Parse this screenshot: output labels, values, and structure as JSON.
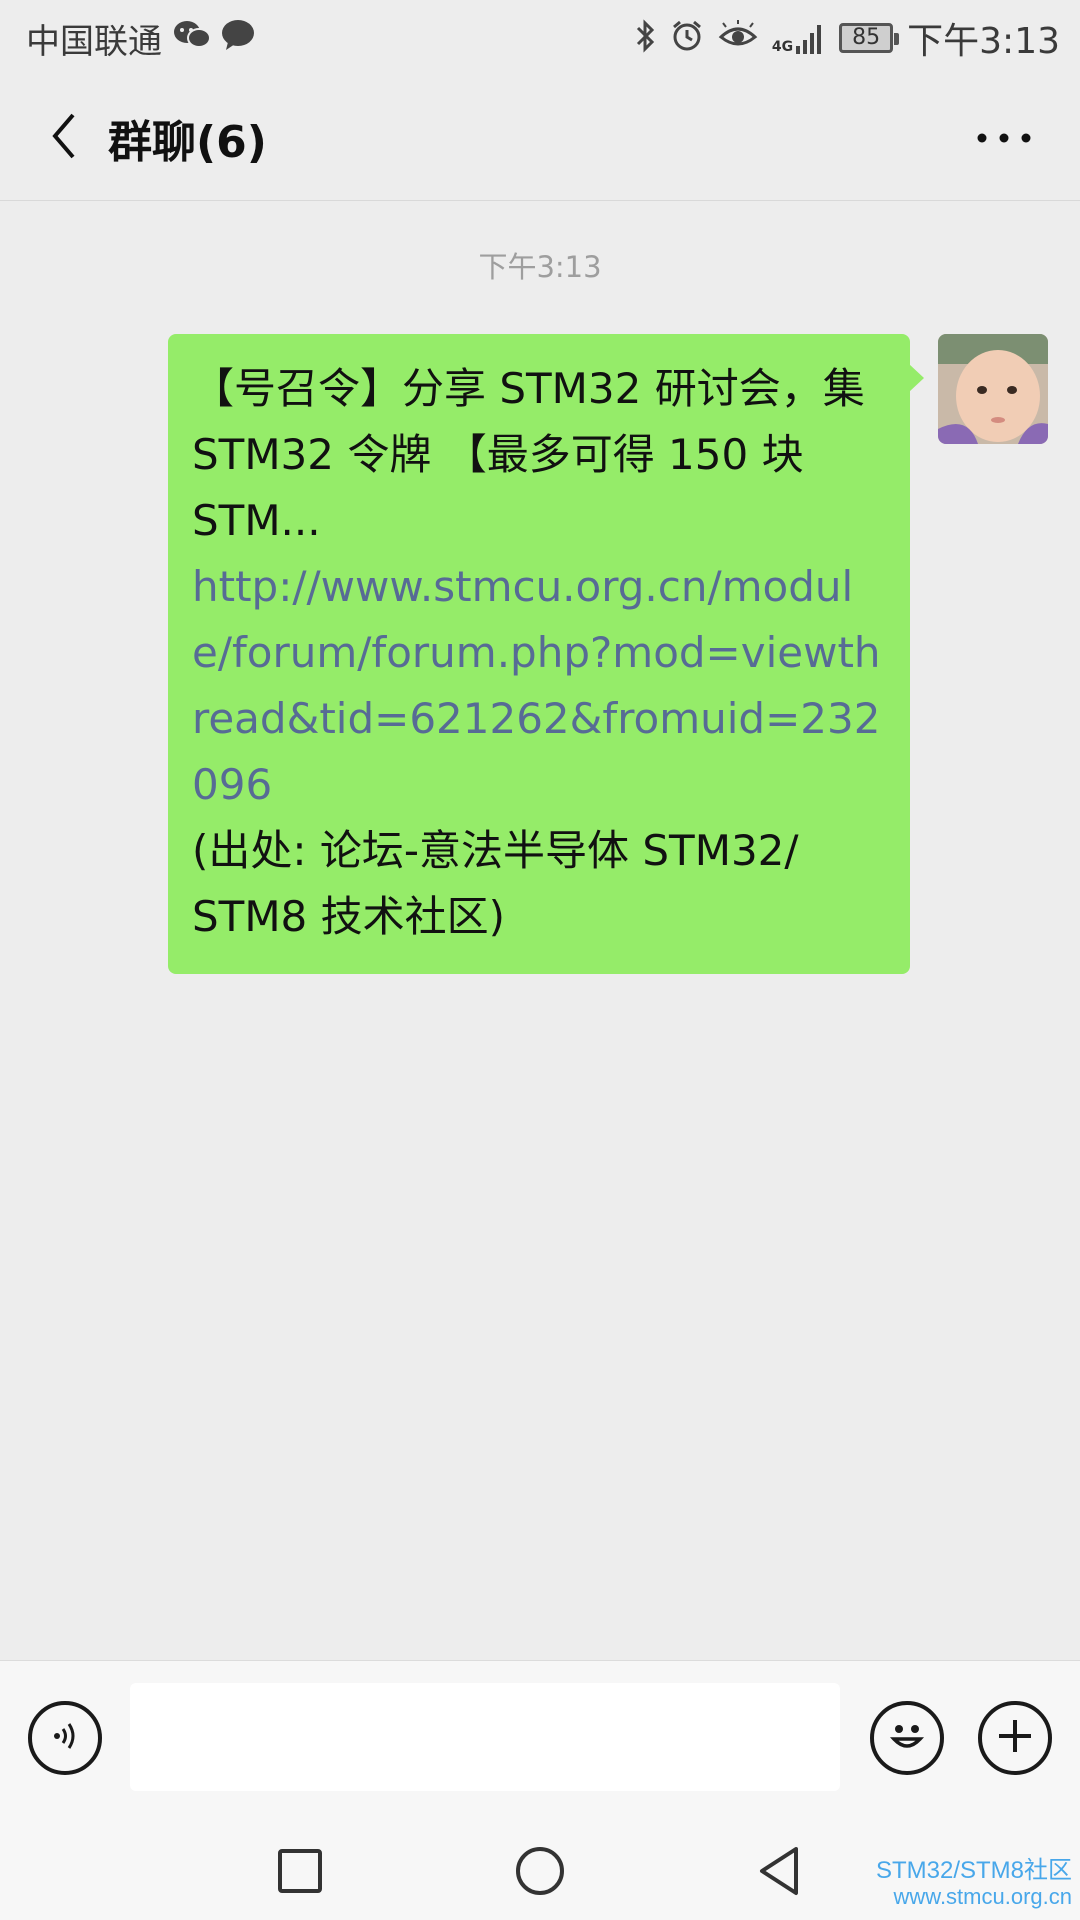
{
  "status_bar": {
    "carrier": "中国联通",
    "network_type": "4G",
    "battery": "85",
    "time": "下午3:13",
    "left_icons": [
      "wechat-icon",
      "message-icon"
    ],
    "right_icons": [
      "bluetooth-icon",
      "alarm-icon",
      "eye-icon",
      "signal-icon",
      "battery-icon"
    ]
  },
  "header": {
    "title": "群聊(6)",
    "back_icon": "chevron-left-icon",
    "more_icon": "more-horizontal-icon"
  },
  "messages": [
    {
      "timestamp": "下午3:13",
      "sender": "self",
      "text_line1": "【号召令】分享 STM32 研讨会，集 STM32 令牌 【最多可得 150 块 STM...",
      "link": "http://www.stmcu.org.cn/module/forum/forum.php?mod=viewthread&tid=621262&fromuid=232096",
      "text_line2": "(出处: 论坛-意法半导体 STM32/ STM8 技术社区)"
    }
  ],
  "input_bar": {
    "voice_icon": "voice-icon",
    "input_value": "",
    "emoji_icon": "emoji-icon",
    "plus_icon": "plus-icon"
  },
  "nav_bar": {
    "icons": [
      "recents-square-icon",
      "home-circle-icon",
      "back-triangle-icon"
    ]
  },
  "watermark": {
    "line1": "STM32/STM8社区",
    "line2": "www.stmcu.org.cn"
  },
  "colors": {
    "background": "#ededed",
    "bubble": "#95ec69",
    "link": "#576b95"
  }
}
